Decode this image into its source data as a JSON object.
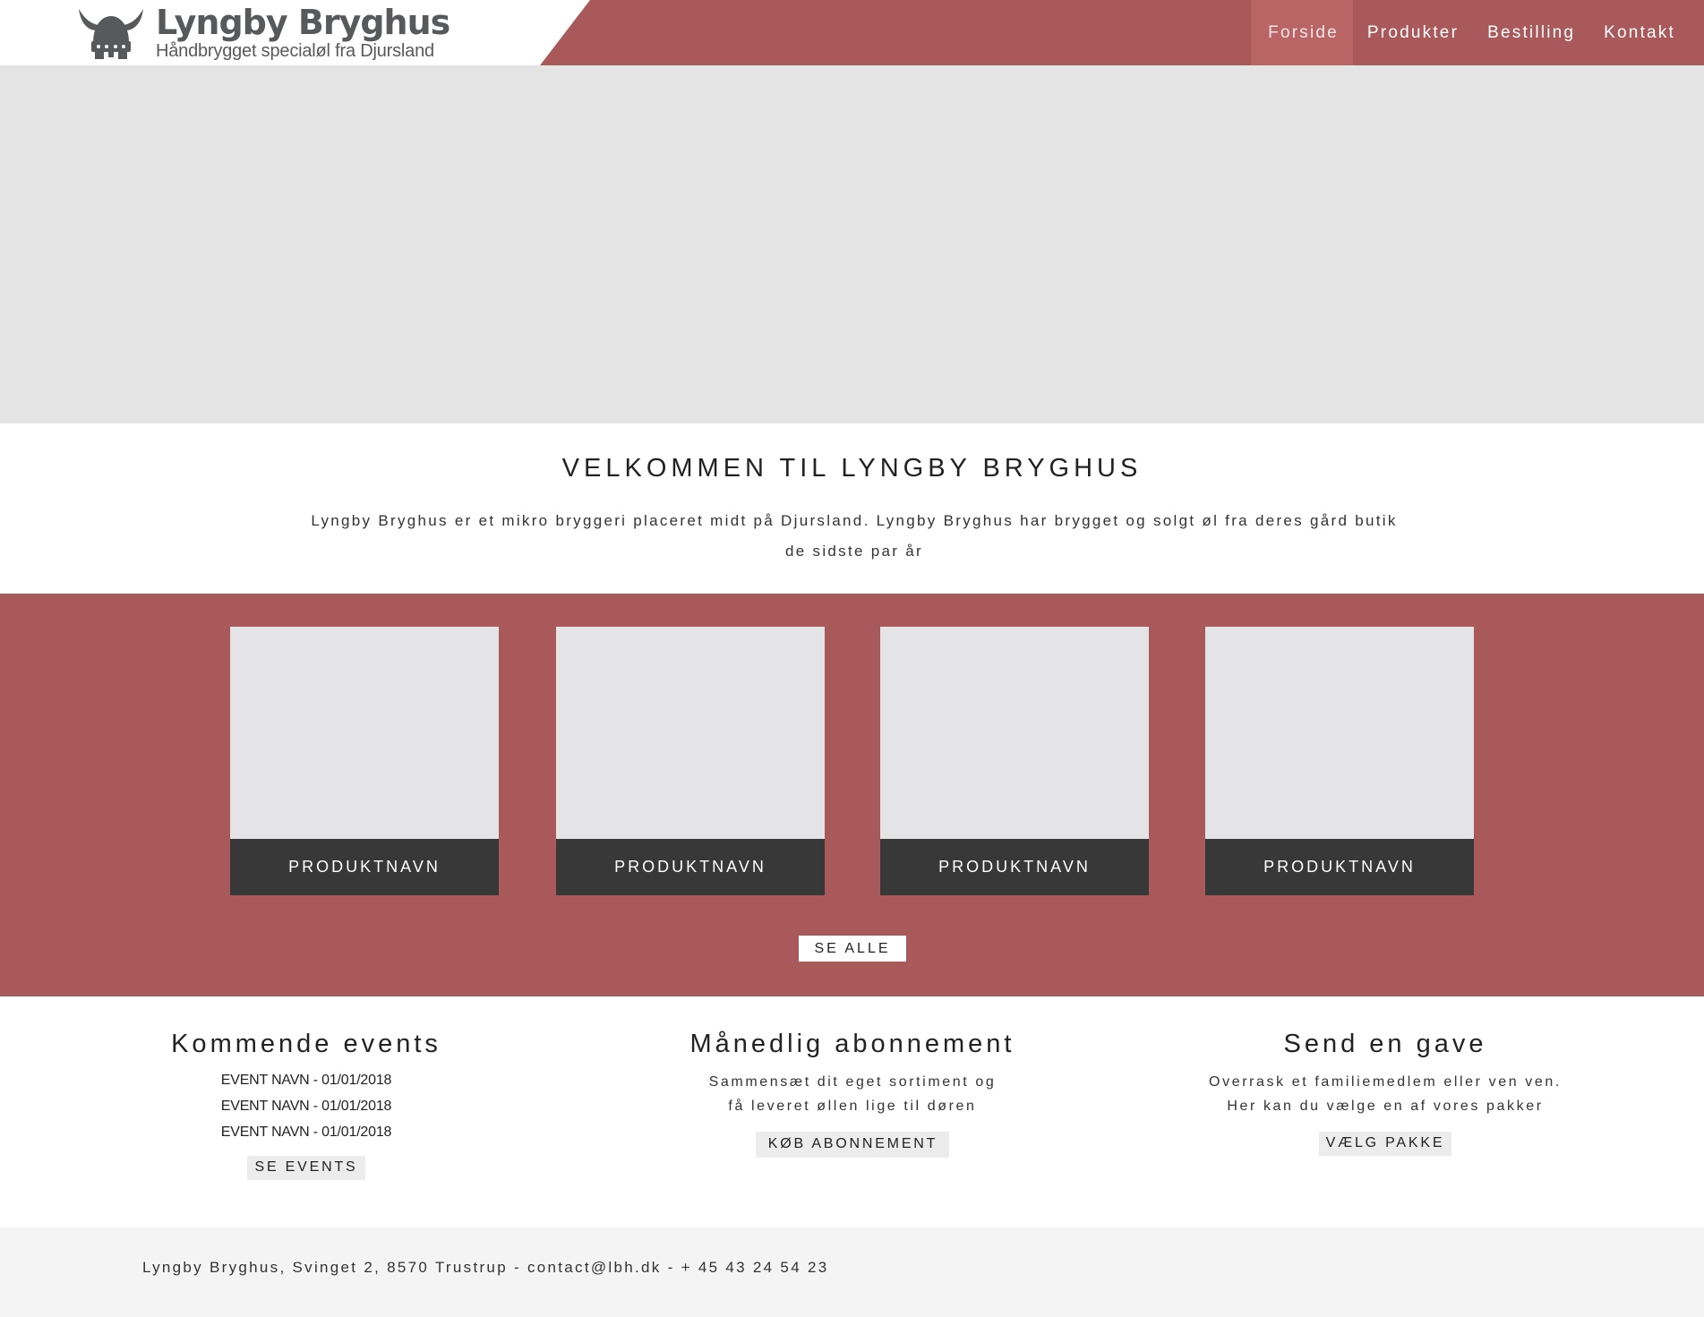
{
  "brand": {
    "title": "Lyngby Bryghus",
    "tagline": "Håndbrygget specialøl fra Djursland",
    "logo_icon": "viking-helmet-icon"
  },
  "colors": {
    "primary_red": "#a9595a",
    "active_nav": "#b96566",
    "dark_label": "#383838",
    "placeholder_grey": "#e4e4e4",
    "footer_bg": "#f4f4f4"
  },
  "nav": {
    "items": [
      {
        "label": "Forside",
        "active": true
      },
      {
        "label": "Produkter",
        "active": false
      },
      {
        "label": "Bestilling",
        "active": false
      },
      {
        "label": "Kontakt",
        "active": false
      }
    ]
  },
  "welcome": {
    "title": "VELKOMMEN TIL LYNGBY BRYGHUS",
    "text": "Lyngby Bryghus er et mikro bryggeri placeret midt på Djursland. Lyngby Bryghus har brygget og solgt øl fra deres gård butik de sidste par år"
  },
  "products": {
    "items": [
      {
        "name": "PRODUKTNAVN"
      },
      {
        "name": "PRODUKTNAVN"
      },
      {
        "name": "PRODUKTNAVN"
      },
      {
        "name": "PRODUKTNAVN"
      }
    ],
    "see_all_label": "SE ALLE"
  },
  "events": {
    "title": "Kommende events",
    "items": [
      "EVENT NAVN - 01/01/2018",
      "EVENT NAVN - 01/01/2018",
      "EVENT NAVN - 01/01/2018"
    ],
    "button_label": "SE EVENTS"
  },
  "subscription": {
    "title": "Månedlig abonnement",
    "line1": "Sammensæt dit eget sortiment og",
    "line2": "få leveret øllen lige til døren",
    "button_label": "KØB ABONNEMENT"
  },
  "gift": {
    "title": "Send en gave",
    "line1": "Overrask et familiemedlem eller ven ven.",
    "line2": "Her kan du vælge en af vores pakker",
    "button_label": "VÆLG PAKKE"
  },
  "footer": {
    "text": "Lyngby Bryghus, Svinget 2, 8570 Trustrup - contact@lbh.dk - + 45 43 24 54 23"
  }
}
